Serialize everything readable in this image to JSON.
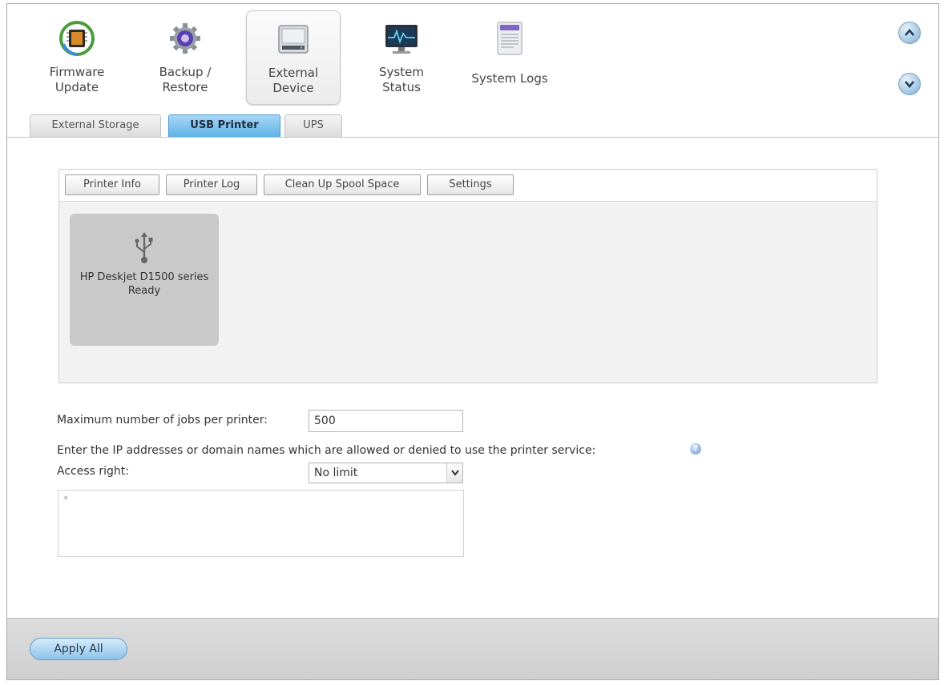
{
  "apps": [
    {
      "label": "Firmware\nUpdate",
      "icon": "firmware-chip-icon"
    },
    {
      "label": "Backup /\nRestore",
      "icon": "backup-gear-icon"
    },
    {
      "label": "External\nDevice",
      "icon": "external-drive-icon"
    },
    {
      "label": "System\nStatus",
      "icon": "monitor-status-icon"
    },
    {
      "label": "System Logs",
      "icon": "log-document-icon"
    }
  ],
  "tabs": [
    {
      "label": "External Storage"
    },
    {
      "label": "USB Printer"
    },
    {
      "label": "UPS"
    }
  ],
  "toolbar": {
    "printer_info": "Printer Info",
    "printer_log": "Printer Log",
    "clean_spool": "Clean Up Spool Space",
    "settings": "Settings"
  },
  "printer": {
    "name": "HP Deskjet D1500 series",
    "status": "Ready",
    "icon": "usb-icon"
  },
  "form": {
    "max_jobs_label": "Maximum number of jobs per printer:",
    "max_jobs_value": "500",
    "ip_instruction": "Enter the IP addresses or domain names which are allowed or denied to use the printer service:",
    "access_label": "Access right:",
    "access_value": "No limit",
    "ip_list_value": "*"
  },
  "footer": {
    "apply_all": "Apply All"
  },
  "colors": {
    "active_tab": "#5fb2e8",
    "tile_bg": "#c9c9c9",
    "panel_bg": "#f2f2f2"
  }
}
